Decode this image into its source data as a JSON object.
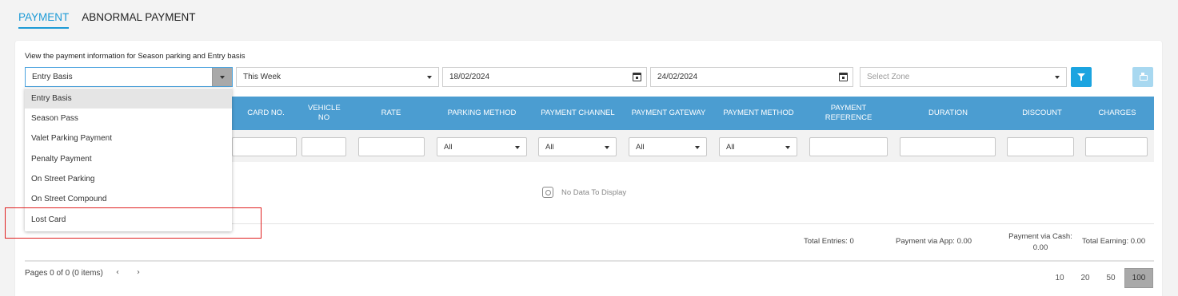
{
  "tabs": [
    {
      "label": "PAYMENT",
      "active": true
    },
    {
      "label": "ABNORMAL PAYMENT",
      "active": false
    }
  ],
  "description": "View the payment information for Season parking and Entry basis",
  "filters": {
    "type_value": "Entry Basis",
    "period_value": "This Week",
    "date_from": "18/02/2024",
    "date_to": "24/02/2024",
    "zone_placeholder": "Select Zone"
  },
  "type_options": [
    "Entry Basis",
    "Season Pass",
    "Valet Parking Payment",
    "Penalty Payment",
    "On Street Parking",
    "On Street Compound",
    "Lost Card"
  ],
  "table": {
    "columns": [
      "CARD NO.",
      "VEHICLE NO",
      "RATE",
      "PARKING METHOD",
      "PAYMENT CHANNEL",
      "PAYMENT GATEWAY",
      "PAYMENT METHOD",
      "PAYMENT REFERENCE",
      "DURATION",
      "DISCOUNT",
      "CHARGES"
    ],
    "filter_all": "All",
    "empty_text": "No Data To Display"
  },
  "summary": {
    "total_entries": "Total Entries: 0",
    "payment_app": "Payment via App: 0.00",
    "payment_cash_label": "Payment via Cash:",
    "payment_cash_value": "0.00",
    "total_earning": "Total Earning: 0.00"
  },
  "pager": {
    "info": "Pages 0 of 0 (0 items)",
    "prev": "‹",
    "next": "›",
    "sizes": [
      "10",
      "20",
      "50",
      "100"
    ],
    "active_size": "100"
  },
  "colors": {
    "accent": "#1c9ad6",
    "header_bg": "#4b9dd1",
    "highlight_box": "#e02020"
  }
}
